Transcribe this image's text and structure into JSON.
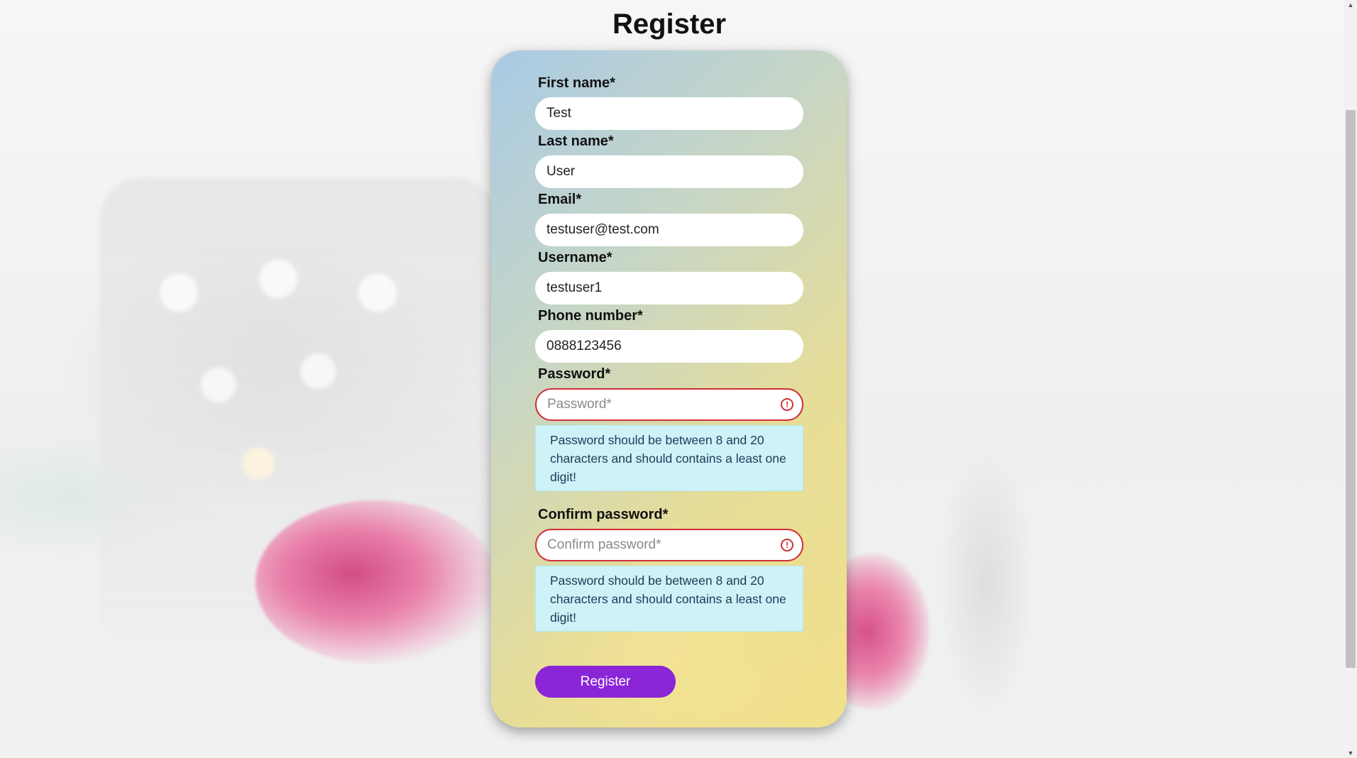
{
  "page": {
    "title": "Register"
  },
  "form": {
    "fields": [
      {
        "label": "First name*",
        "value": "Test",
        "placeholder": ""
      },
      {
        "label": "Last name*",
        "value": "User",
        "placeholder": ""
      },
      {
        "label": "Email*",
        "value": "testuser@test.com",
        "placeholder": ""
      },
      {
        "label": "Username*",
        "value": "testuser1",
        "placeholder": ""
      },
      {
        "label": "Phone number*",
        "value": "0888123456",
        "placeholder": ""
      },
      {
        "label": "Password*",
        "value": "",
        "placeholder": "Password*",
        "error": true,
        "hint": "Password should be between 8 and 20 characters and should contains a least one digit!"
      },
      {
        "label": "Confirm password*",
        "value": "",
        "placeholder": "Confirm password*",
        "error": true,
        "hint": "Password should be between 8 and 20 characters and should contains a least one digit!"
      }
    ],
    "submit_label": "Register"
  },
  "icons": {
    "error": "alert-circle-icon",
    "scroll_up": "scroll-up-arrow",
    "scroll_down": "scroll-down-arrow"
  },
  "colors": {
    "accent": "#8a25d8",
    "error": "#d0303a",
    "hint_bg": "#cdf3f9"
  }
}
